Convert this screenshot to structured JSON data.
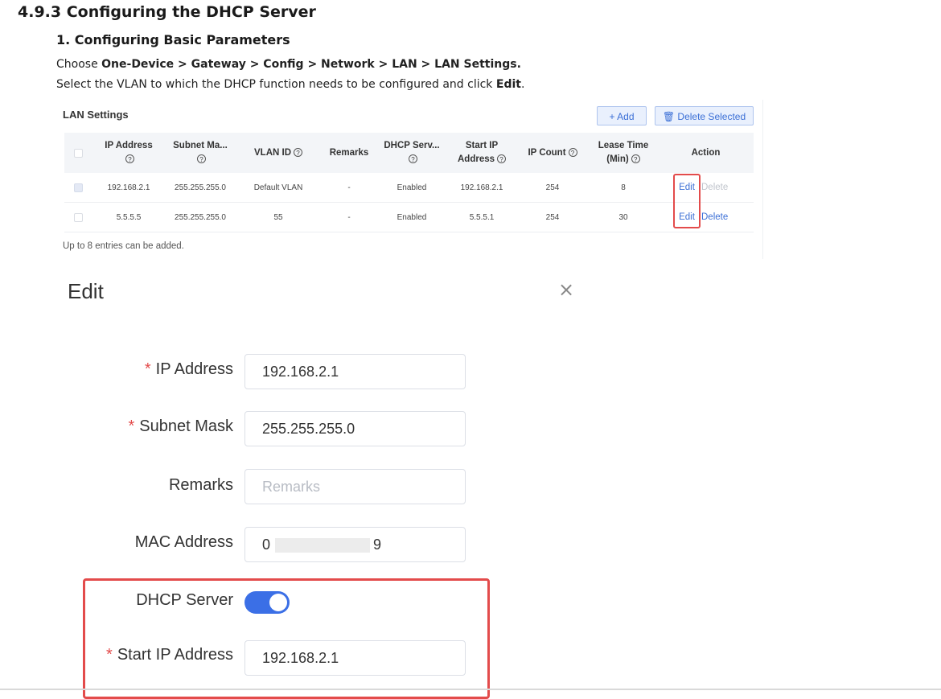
{
  "doc": {
    "section_title": "4.9.3  Configuring the DHCP Server",
    "subsection_title": "1.  Configuring Basic Parameters",
    "step1_prefix": "Choose ",
    "step1_path": "One-Device > Gateway > Config > Network > LAN > LAN Settings.",
    "step2_prefix": "Select the VLAN to which the DHCP function needs to be configured and click ",
    "step2_bold": "Edit",
    "step2_suffix": "."
  },
  "lan": {
    "title": "LAN Settings",
    "add_label": "+ Add",
    "delete_selected_label": "🗑 Delete Selected",
    "columns": {
      "ip": "IP Address",
      "subnet": "Subnet Ma...",
      "vlan": "VLAN ID",
      "remarks": "Remarks",
      "dhcp": "DHCP Serv...",
      "start_ip_1": "Start IP",
      "start_ip_2": "Address",
      "ip_count": "IP Count",
      "lease_1": "Lease Time",
      "lease_2": "(Min)",
      "action": "Action"
    },
    "rows": [
      {
        "ip": "192.168.2.1",
        "subnet": "255.255.255.0",
        "vlan": "Default VLAN",
        "remarks": "-",
        "dhcp": "Enabled",
        "start_ip": "192.168.2.1",
        "ip_count": "254",
        "lease": "8",
        "edit": "Edit",
        "delete": "Delete",
        "delete_disabled": true
      },
      {
        "ip": "5.5.5.5",
        "subnet": "255.255.255.0",
        "vlan": "55",
        "remarks": "-",
        "dhcp": "Enabled",
        "start_ip": "5.5.5.1",
        "ip_count": "254",
        "lease": "30",
        "edit": "Edit",
        "delete": "Delete",
        "delete_disabled": false
      }
    ],
    "note": "Up to 8 entries can be added."
  },
  "edit": {
    "title": "Edit",
    "close_icon": "×",
    "fields": {
      "ip_label": "IP Address",
      "ip_value": "192.168.2.1",
      "subnet_label": "Subnet Mask",
      "subnet_value": "255.255.255.0",
      "remarks_label": "Remarks",
      "remarks_placeholder": "Remarks",
      "mac_label": "MAC Address",
      "mac_start": "0",
      "mac_end": "9",
      "dhcp_label": "DHCP Server",
      "dhcp_enabled": true,
      "start_ip_label": "Start IP Address",
      "start_ip_value": "192.168.2.1"
    },
    "required_mark": "*"
  },
  "colors": {
    "accent": "#3b6fe6",
    "highlight": "#e34b4b"
  }
}
